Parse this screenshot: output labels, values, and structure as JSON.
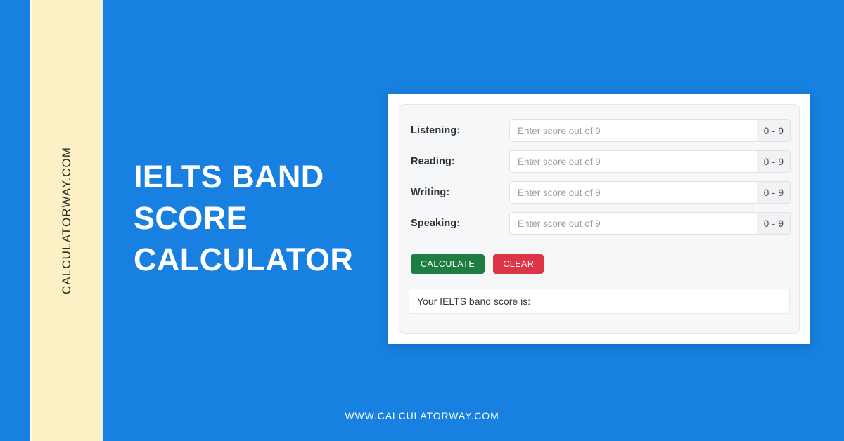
{
  "theme": {
    "background_blue": "#1780e0",
    "strip_cream": "#fcf0c4",
    "calculate_green": "#1e7e40",
    "clear_red": "#dc3545",
    "card_white": "#ffffff",
    "panel_gray": "#f6f7f8"
  },
  "brand": {
    "vertical_text": "CALCULATORWAY.COM",
    "footer_url": "WWW.CALCULATORWAY.COM"
  },
  "headline": {
    "line1": "IELTS BAND",
    "line2": "SCORE",
    "line3": "CALCULATOR"
  },
  "calculator": {
    "rows": [
      {
        "label": "Listening:",
        "value": "",
        "placeholder": "Enter score out of 9",
        "range": "0 - 9"
      },
      {
        "label": "Reading:",
        "value": "",
        "placeholder": "Enter score out of 9",
        "range": "0 - 9"
      },
      {
        "label": "Writing:",
        "value": "",
        "placeholder": "Enter score out of 9",
        "range": "0 - 9"
      },
      {
        "label": "Speaking:",
        "value": "",
        "placeholder": "Enter score out of 9",
        "range": "0 - 9"
      }
    ],
    "buttons": {
      "calculate": "CALCULATE",
      "clear": "CLEAR"
    },
    "result": {
      "label": "Your IELTS band score is:",
      "value": ""
    }
  }
}
